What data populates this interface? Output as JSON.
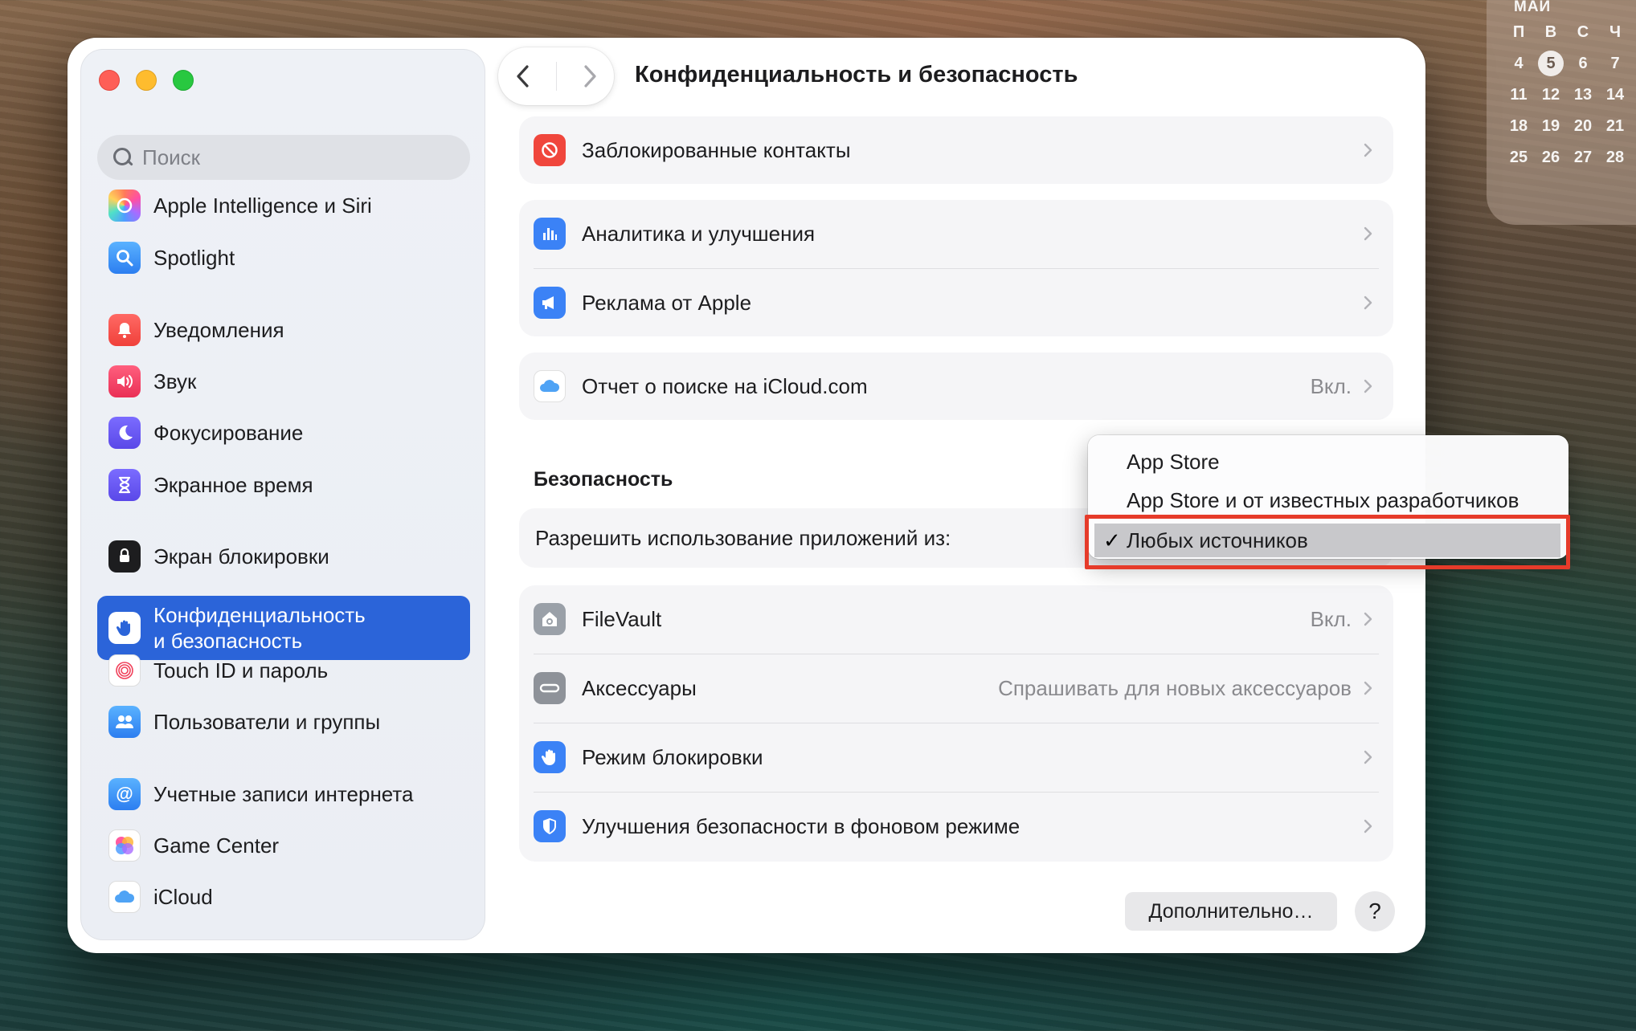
{
  "calendar": {
    "month": "МАЙ",
    "weekdays": [
      "П",
      "В",
      "С",
      "Ч"
    ],
    "weeks": [
      [
        "4",
        "5",
        "6",
        "7"
      ],
      [
        "11",
        "12",
        "13",
        "14"
      ],
      [
        "18",
        "19",
        "20",
        "21"
      ],
      [
        "25",
        "26",
        "27",
        "28"
      ]
    ],
    "today": "5"
  },
  "window": {
    "title": "Конфиденциальность и безопасность"
  },
  "sidebar": {
    "search_placeholder": "Поиск",
    "items": [
      {
        "label": "Apple Intelligence и Siri",
        "icon": "apple-intelligence-icon"
      },
      {
        "label": "Spotlight",
        "icon": "spotlight-icon"
      },
      {
        "label": "Уведомления",
        "icon": "notifications-icon"
      },
      {
        "label": "Звук",
        "icon": "sound-icon"
      },
      {
        "label": "Фокусирование",
        "icon": "focus-moon-icon"
      },
      {
        "label": "Экранное время",
        "icon": "hourglass-icon"
      },
      {
        "label": "Экран блокировки",
        "icon": "lock-screen-icon"
      },
      {
        "label": "Конфиденциальность\nи безопасность",
        "icon": "hand-privacy-icon",
        "selected": true
      },
      {
        "label": "Touch ID и пароль",
        "icon": "fingerprint-icon"
      },
      {
        "label": "Пользователи и группы",
        "icon": "users-icon"
      },
      {
        "label": "Учетные записи интернета",
        "icon": "at-sign-icon"
      },
      {
        "label": "Game Center",
        "icon": "game-center-icon"
      },
      {
        "label": "iCloud",
        "icon": "icloud-icon"
      }
    ]
  },
  "privacy": {
    "blocked_contacts": "Заблокированные контакты",
    "analytics": "Аналитика и улучшения",
    "apple_ads": "Реклама от Apple",
    "icloud_report": "Отчет о поиске на iCloud.com",
    "icloud_report_value": "Вкл."
  },
  "security": {
    "section_title": "Безопасность",
    "allow_apps_label": "Разрешить использование приложений из:",
    "rows": [
      {
        "label": "FileVault",
        "value": "Вкл.",
        "icon": "filevault-icon"
      },
      {
        "label": "Аксессуары",
        "value": "Спрашивать для новых аксессуаров",
        "icon": "accessories-icon"
      },
      {
        "label": "Режим блокировки",
        "value": "",
        "icon": "lockdown-hand-icon"
      },
      {
        "label": "Улучшения безопасности в фоновом режиме",
        "value": "",
        "icon": "shield-icon"
      }
    ]
  },
  "popup_menu": {
    "options": [
      "App Store",
      "App Store и от известных разработчиков",
      "Любых источников"
    ],
    "selected": "Любых источников",
    "check_glyph": "✓"
  },
  "footer": {
    "advanced_button": "Дополнительно…",
    "help_button": "?"
  },
  "colors": {
    "accent": "#2b64d9",
    "highlight_box": "#e63b2a"
  }
}
